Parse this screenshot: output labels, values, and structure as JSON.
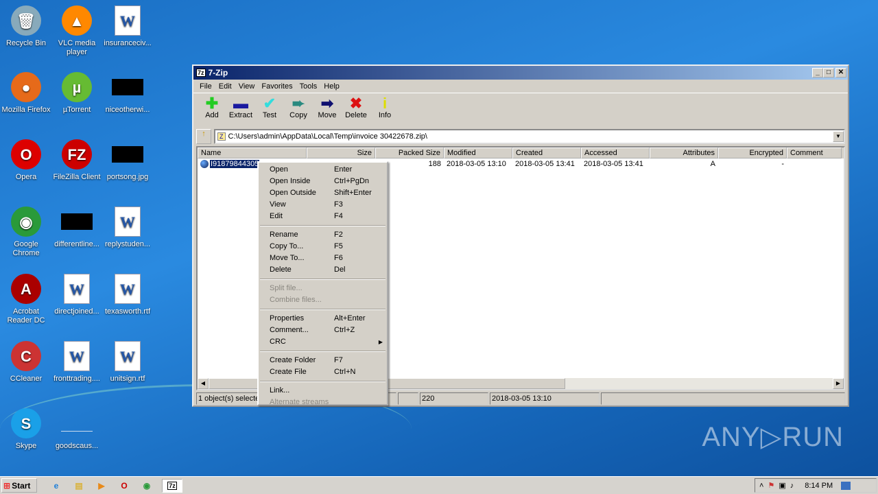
{
  "desktop": {
    "icons": [
      {
        "label": "Recycle Bin",
        "glyph": "🗑"
      },
      {
        "label": "VLC media player",
        "glyph": "▲"
      },
      {
        "label": "insuranceciv...",
        "glyph": "W"
      },
      {
        "label": "Mozilla Firefox",
        "glyph": "●"
      },
      {
        "label": "µTorrent",
        "glyph": "µ"
      },
      {
        "label": "niceotherwi...",
        "glyph": ""
      },
      {
        "label": "Opera",
        "glyph": "O"
      },
      {
        "label": "FileZilla Client",
        "glyph": "FZ"
      },
      {
        "label": "portsong.jpg",
        "glyph": ""
      },
      {
        "label": "Google Chrome",
        "glyph": "◉"
      },
      {
        "label": "differentline...",
        "glyph": ""
      },
      {
        "label": "replystuden...",
        "glyph": "W"
      },
      {
        "label": "Acrobat Reader DC",
        "glyph": "A"
      },
      {
        "label": "directjoined...",
        "glyph": "W"
      },
      {
        "label": "texasworth.rtf",
        "glyph": "W"
      },
      {
        "label": "CCleaner",
        "glyph": "C"
      },
      {
        "label": "fronttrading....",
        "glyph": "W"
      },
      {
        "label": "unitsign.rtf",
        "glyph": "W"
      },
      {
        "label": "Skype",
        "glyph": "S"
      },
      {
        "label": "goodscaus...",
        "glyph": ""
      }
    ]
  },
  "window": {
    "icon": "7z",
    "title": "7-Zip",
    "menu": [
      "File",
      "Edit",
      "View",
      "Favorites",
      "Tools",
      "Help"
    ],
    "toolbar": [
      {
        "label": "Add",
        "glyph": "✚",
        "color": "#22cc22"
      },
      {
        "label": "Extract",
        "glyph": "▬",
        "color": "#1a1aa0"
      },
      {
        "label": "Test",
        "glyph": "✔",
        "color": "#33dddd"
      },
      {
        "label": "Copy",
        "glyph": "➨",
        "color": "#2a8a80"
      },
      {
        "label": "Move",
        "glyph": "➡",
        "color": "#101070"
      },
      {
        "label": "Delete",
        "glyph": "✖",
        "color": "#dd1111"
      },
      {
        "label": "Info",
        "glyph": "i",
        "color": "#dddd00"
      }
    ],
    "path": "C:\\Users\\admin\\AppData\\Local\\Temp\\invoice 30422678.zip\\",
    "columns": [
      "Name",
      "Size",
      "Packed Size",
      "Modified",
      "Created",
      "Accessed",
      "Attributes",
      "Encrypted",
      "Comment"
    ],
    "rows": [
      [
        "I91879844305",
        "",
        "188",
        "2018-03-05 13:10",
        "2018-03-05 13:41",
        "2018-03-05 13:41",
        "A",
        "-",
        ""
      ]
    ],
    "status": [
      "1 object(s) selected",
      "",
      "220",
      "2018-03-05 13:10"
    ]
  },
  "context_menu": [
    {
      "label": "Open",
      "key": "Enter"
    },
    {
      "label": "Open Inside",
      "key": "Ctrl+PgDn"
    },
    {
      "label": "Open Outside",
      "key": "Shift+Enter"
    },
    {
      "label": "View",
      "key": "F3"
    },
    {
      "label": "Edit",
      "key": "F4"
    },
    {
      "sep": true
    },
    {
      "label": "Rename",
      "key": "F2"
    },
    {
      "label": "Copy To...",
      "key": "F5"
    },
    {
      "label": "Move To...",
      "key": "F6"
    },
    {
      "label": "Delete",
      "key": "Del"
    },
    {
      "sep": true
    },
    {
      "label": "Split file...",
      "key": "",
      "disabled": true
    },
    {
      "label": "Combine files...",
      "key": "",
      "disabled": true
    },
    {
      "sep": true
    },
    {
      "label": "Properties",
      "key": "Alt+Enter"
    },
    {
      "label": "Comment...",
      "key": "Ctrl+Z"
    },
    {
      "label": "CRC",
      "key": "",
      "submenu": true
    },
    {
      "sep": true
    },
    {
      "label": "Create Folder",
      "key": "F7"
    },
    {
      "label": "Create File",
      "key": "Ctrl+N"
    },
    {
      "sep": true
    },
    {
      "label": "Link...",
      "key": ""
    },
    {
      "label": "Alternate streams",
      "key": "",
      "disabled": true
    }
  ],
  "taskbar": {
    "start": "Start",
    "clock": "8:14 PM",
    "active": "7z"
  },
  "watermark": "ANY▷RUN"
}
